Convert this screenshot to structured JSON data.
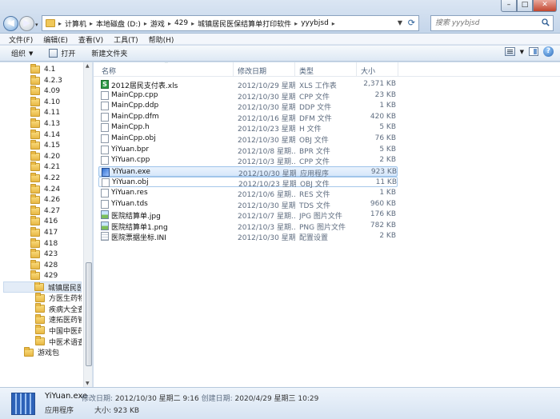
{
  "address": {
    "crumbs": [
      "计算机",
      "本地磁盘 (D:)",
      "游戏",
      "429",
      "城镇居民医保结算单打印软件",
      "yyybjsd"
    ]
  },
  "search": {
    "placeholder": "搜索 yyybjsd"
  },
  "menu": [
    "文件(F)",
    "编辑(E)",
    "查看(V)",
    "工具(T)",
    "帮助(H)"
  ],
  "toolbar": {
    "organize": "组织",
    "open": "打开",
    "new_folder": "新建文件夹"
  },
  "nav": {
    "folders": [
      "4.1",
      "4.2.3",
      "4.09",
      "4.10",
      "4.11",
      "4.13",
      "4.14",
      "4.15",
      "4.20",
      "4.21",
      "4.22",
      "4.24",
      "4.26",
      "4.27",
      "416",
      "417",
      "418",
      "423",
      "428",
      "429"
    ],
    "subfolders": [
      "城镇居民医保",
      "方医生药物手",
      "疾病大全查询",
      "速拓医药管理",
      "中国中医药遗",
      "中医术语查询"
    ],
    "bottom": [
      "游戏包"
    ]
  },
  "columns": {
    "name": "名称",
    "date": "修改日期",
    "type": "类型",
    "size": "大小"
  },
  "files": [
    {
      "name": "2012居民支付表.xls",
      "date": "2012/10/29 星期...",
      "type": "XLS 工作表",
      "size": "2,371 KB",
      "icon": "xls"
    },
    {
      "name": "MainCpp.cpp",
      "date": "2012/10/30 星期...",
      "type": "CPP 文件",
      "size": "23 KB",
      "icon": "doc"
    },
    {
      "name": "MainCpp.ddp",
      "date": "2012/10/30 星期...",
      "type": "DDP 文件",
      "size": "1 KB",
      "icon": "doc"
    },
    {
      "name": "MainCpp.dfm",
      "date": "2012/10/16 星期...",
      "type": "DFM 文件",
      "size": "420 KB",
      "icon": "doc"
    },
    {
      "name": "MainCpp.h",
      "date": "2012/10/23 星期...",
      "type": "H 文件",
      "size": "5 KB",
      "icon": "doc"
    },
    {
      "name": "MainCpp.obj",
      "date": "2012/10/30 星期...",
      "type": "OBJ 文件",
      "size": "76 KB",
      "icon": "doc"
    },
    {
      "name": "YiYuan.bpr",
      "date": "2012/10/8 星期...",
      "type": "BPR 文件",
      "size": "5 KB",
      "icon": "doc"
    },
    {
      "name": "YiYuan.cpp",
      "date": "2012/10/3 星期...",
      "type": "CPP 文件",
      "size": "2 KB",
      "icon": "doc"
    },
    {
      "name": "YiYuan.exe",
      "date": "2012/10/30 星期...",
      "type": "应用程序",
      "size": "923 KB",
      "icon": "exe"
    },
    {
      "name": "YiYuan.obj",
      "date": "2012/10/23 星期...",
      "type": "OBJ 文件",
      "size": "11 KB",
      "icon": "doc"
    },
    {
      "name": "YiYuan.res",
      "date": "2012/10/6 星期...",
      "type": "RES 文件",
      "size": "1 KB",
      "icon": "doc"
    },
    {
      "name": "YiYuan.tds",
      "date": "2012/10/30 星期...",
      "type": "TDS 文件",
      "size": "960 KB",
      "icon": "doc"
    },
    {
      "name": "医院结算单.jpg",
      "date": "2012/10/7 星期...",
      "type": "JPG 图片文件",
      "size": "176 KB",
      "icon": "img"
    },
    {
      "name": "医院结算单1.png",
      "date": "2012/10/3 星期...",
      "type": "PNG 图片文件",
      "size": "782 KB",
      "icon": "img"
    },
    {
      "name": "医院票据坐标.INI",
      "date": "2012/10/30 星期...",
      "type": "配置设置",
      "size": "2 KB",
      "icon": "ini"
    }
  ],
  "details": {
    "name": "YiYuan.exe",
    "modified_label": "修改日期:",
    "modified": "2012/10/30 星期二 9:16",
    "created_label": "创建日期:",
    "created": "2020/4/29 星期三 10:29",
    "type": "应用程序",
    "size_label": "大小:",
    "size": "923 KB"
  }
}
